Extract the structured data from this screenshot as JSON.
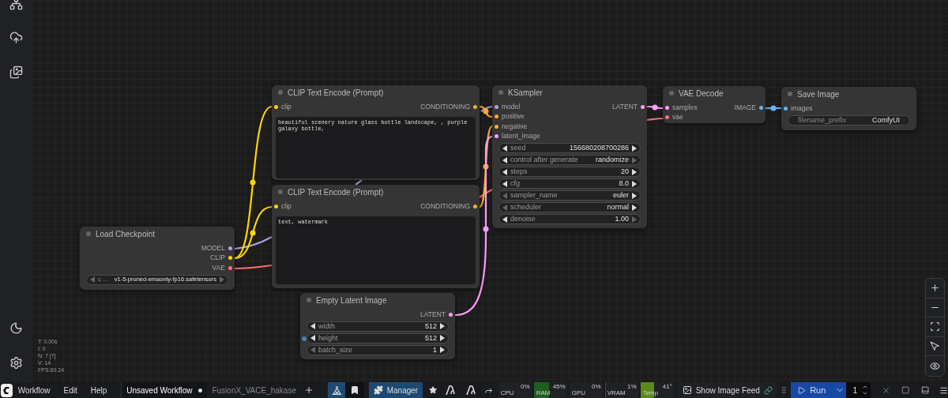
{
  "nodes": [
    {
      "title": "CLIP Text Encode (Prompt)",
      "inputs": [
        {
          "name": "clip",
          "color": "#ffd500"
        }
      ],
      "outputs": [
        {
          "name": "CONDITIONING",
          "color": "#ffa931"
        }
      ],
      "text": "beautiful scenery nature glass bottle landscape, , purple galaxy bottle,"
    },
    {
      "title": "CLIP Text Encode (Prompt)",
      "inputs": [
        {
          "name": "clip",
          "color": "#ffd500"
        }
      ],
      "outputs": [
        {
          "name": "CONDITIONING",
          "color": "#ffa931"
        }
      ],
      "text": "text, watermark"
    },
    {
      "title": "KSampler",
      "inputs": [
        {
          "name": "model",
          "color": "#b39ddb"
        },
        {
          "name": "positive",
          "color": "#ffa931"
        },
        {
          "name": "negative",
          "color": "#ffa931"
        },
        {
          "name": "latent_image",
          "color": "#ff9cf9"
        }
      ],
      "outputs": [
        {
          "name": "LATENT",
          "color": "#ff9cf9"
        }
      ],
      "widgets": [
        {
          "kind": "number",
          "label": "seed",
          "value": "156680208700286",
          "prev_enabled": true,
          "next_enabled": true
        },
        {
          "kind": "combo",
          "label": "control after generate",
          "value": "randomize",
          "prev_enabled": true,
          "next_enabled": false
        },
        {
          "kind": "number",
          "label": "steps",
          "value": "20",
          "prev_enabled": true,
          "next_enabled": true
        },
        {
          "kind": "number",
          "label": "cfg",
          "value": "8.0",
          "prev_enabled": true,
          "next_enabled": true
        },
        {
          "kind": "combo",
          "label": "sampler_name",
          "value": "euler",
          "prev_enabled": false,
          "next_enabled": true
        },
        {
          "kind": "combo",
          "label": "scheduler",
          "value": "normal",
          "prev_enabled": false,
          "next_enabled": true
        },
        {
          "kind": "number",
          "label": "denoise",
          "value": "1.00",
          "prev_enabled": true,
          "next_enabled": false
        }
      ]
    },
    {
      "title": "VAE Decode",
      "inputs": [
        {
          "name": "samples",
          "color": "#ff9cf9"
        },
        {
          "name": "vae",
          "color": "#ff6e6e"
        }
      ],
      "outputs": [
        {
          "name": "IMAGE",
          "color": "#64b5f6"
        }
      ]
    },
    {
      "title": "Save Image",
      "inputs": [
        {
          "name": "images",
          "color": "#64b5f6"
        }
      ],
      "widgets": [
        {
          "kind": "text",
          "label": "filename_prefix",
          "value": "ComfyUI"
        }
      ]
    },
    {
      "title": "Load Checkpoint",
      "outputs": [
        {
          "name": "MODEL",
          "color": "#b39ddb"
        },
        {
          "name": "CLIP",
          "color": "#ffd500"
        },
        {
          "name": "VAE",
          "color": "#ff6e6e"
        }
      ],
      "widgets": [
        {
          "kind": "combo",
          "label": "c …",
          "value": "v1-5-pruned-emaonly-fp16.safetensors",
          "prev_enabled": false,
          "next_enabled": false
        }
      ]
    },
    {
      "title": "Empty Latent Image",
      "outputs": [
        {
          "name": "LATENT",
          "color": "#ff9cf9"
        }
      ],
      "widgets": [
        {
          "kind": "number",
          "label": "width",
          "value": "512",
          "prev_enabled": true,
          "next_enabled": true,
          "linked": false
        },
        {
          "kind": "number",
          "label": "height",
          "value": "512",
          "prev_enabled": true,
          "next_enabled": true,
          "linked": true
        },
        {
          "kind": "number",
          "label": "batch_size",
          "value": "1",
          "prev_enabled": false,
          "next_enabled": true,
          "linked": false
        }
      ]
    }
  ],
  "stats": [
    "T: 0.00s",
    "I: 0",
    "N: 7 [7]",
    "V: 14",
    "FPS:60.24"
  ],
  "menubar": [
    "Workflow",
    "Edit",
    "Help"
  ],
  "workflow_tabs": [
    {
      "label": "Unsaved Workflow",
      "selected": true,
      "unsaved": true
    },
    {
      "label": "FusionX_VACE_hakase",
      "selected": false,
      "unsaved": false
    }
  ],
  "manager_button": "Manager",
  "monitors": [
    {
      "label": "CPU",
      "value": "0%"
    },
    {
      "label": "RAM",
      "value": "45%",
      "level": 0.45,
      "color": "#1e5e1e"
    },
    {
      "label": "GPU",
      "value": "0%"
    },
    {
      "label": "VRAM",
      "value": "1%",
      "level": 0.01,
      "color": "#1e5e1e"
    },
    {
      "label": "Temp",
      "value": "41°",
      "level": 0.41,
      "color": "#5a8a1a"
    }
  ],
  "image_feed_button": "Show Image Feed",
  "run_button": "Run",
  "batch_count": "1"
}
